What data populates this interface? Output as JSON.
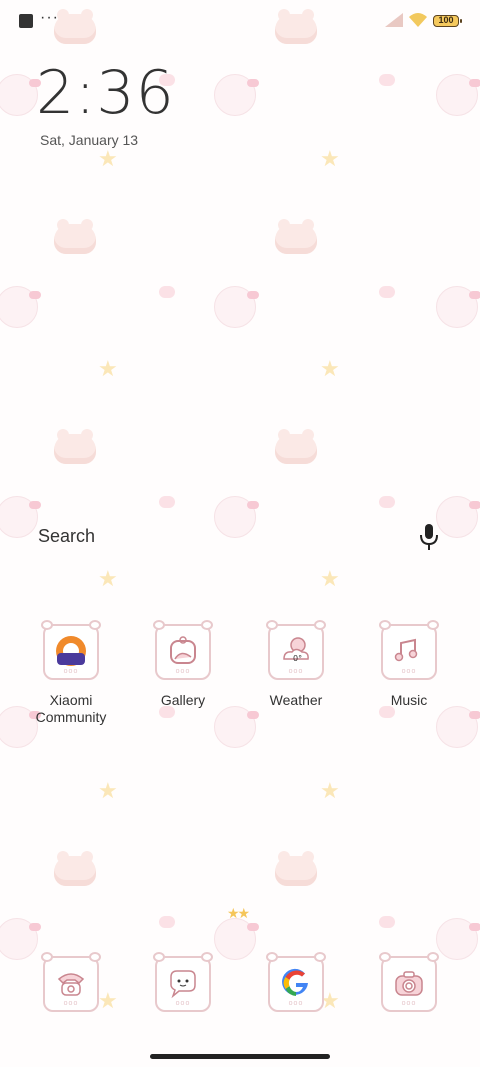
{
  "status_bar": {
    "notification_icon": "square-notification-icon",
    "more_indicator": "···",
    "signal_icon": "signal-icon",
    "wifi_icon": "wifi-icon",
    "battery_level": "100"
  },
  "clock": {
    "time": "2:36",
    "date": "Sat, January 13"
  },
  "search": {
    "label": "Search",
    "mic_icon": "microphone-icon"
  },
  "apps_row1": [
    {
      "label": "Xiaomi\nCommunity",
      "icon": "xiaomi-community-icon"
    },
    {
      "label": "Gallery",
      "icon": "gallery-icon"
    },
    {
      "label": "Weather",
      "icon": "weather-icon",
      "temp": "0°"
    },
    {
      "label": "Music",
      "icon": "music-icon"
    }
  ],
  "dock": [
    {
      "icon": "phone-icon"
    },
    {
      "icon": "messages-icon"
    },
    {
      "icon": "google-icon"
    },
    {
      "icon": "camera-icon"
    }
  ],
  "colors": {
    "accent_pink": "#e8c9cc",
    "battery_fill": "#f5c95d"
  }
}
